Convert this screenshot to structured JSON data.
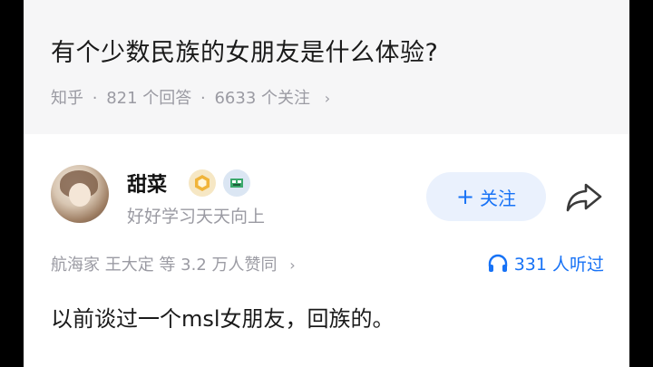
{
  "question": {
    "title": "有个少数民族的女朋友是什么体验?",
    "source": "知乎",
    "answers": "821 个回答",
    "followers": "6633 个关注",
    "sep": "·"
  },
  "author": {
    "name": "甜菜",
    "bio": "好好学习天天向上",
    "follow_label": "关注",
    "avatar_icon": "avatar",
    "gold_badge_icon": "medal-icon",
    "pic_badge_icon": "pixel-badge-icon"
  },
  "stats": {
    "likes_text": "航海家 王大定 等 3.2 万人赞同",
    "listen_text": "331 人听过"
  },
  "answer": {
    "text": "以前谈过一个msl女朋友，回族的。"
  },
  "colors": {
    "accent": "#1772f6",
    "follow_bg": "#eaf1fd",
    "meta_text": "#9b9ba3",
    "question_bg": "#f6f6f7"
  }
}
